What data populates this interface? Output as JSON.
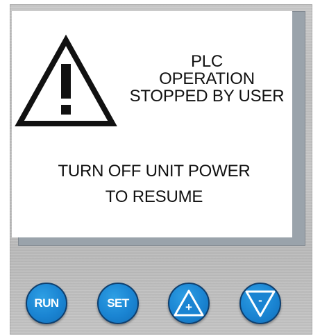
{
  "screen": {
    "title_lines": [
      "PLC",
      "OPERATION",
      "STOPPED BY USER"
    ],
    "resume_lines": [
      "TURN OFF UNIT POWER",
      "TO RESUME"
    ],
    "warning_icon": "warning-triangle-icon"
  },
  "buttons": {
    "run_label": "RUN",
    "set_label": "SET",
    "up_label": "+",
    "down_label": "-",
    "up_icon": "triangle-up-icon",
    "down_icon": "triangle-down-icon"
  },
  "colors": {
    "button_blue": "#1a84d2",
    "panel_gray": "#c3c3c3",
    "screen_bg": "#ffffff"
  }
}
